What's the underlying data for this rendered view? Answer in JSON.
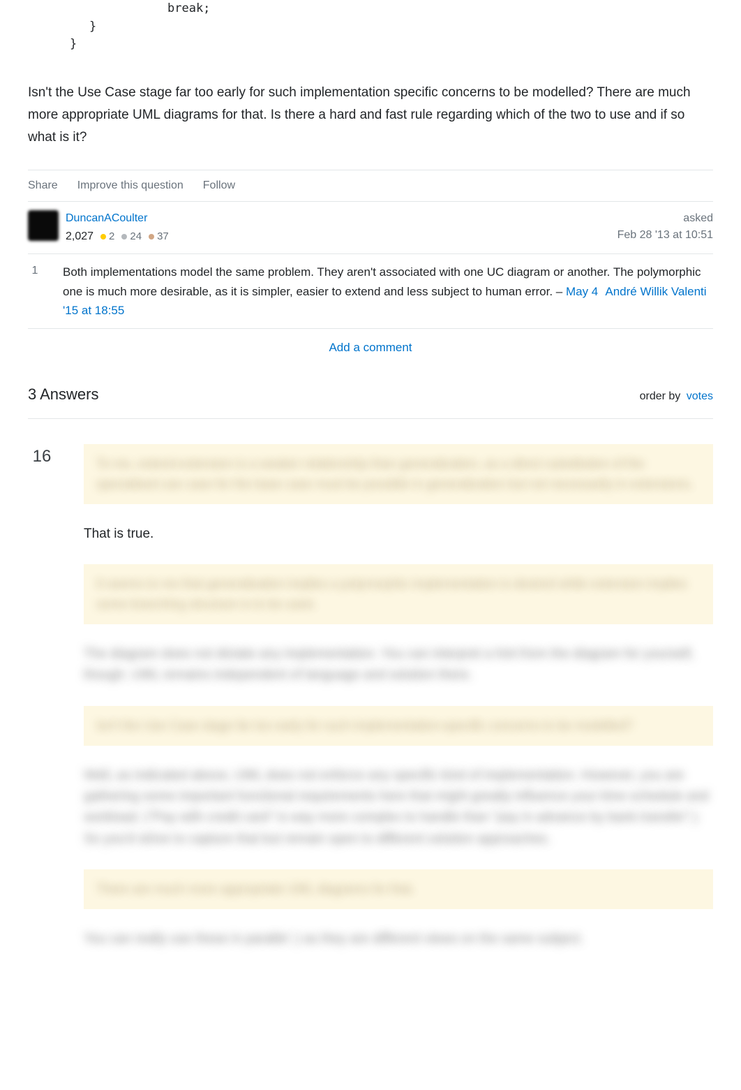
{
  "code": {
    "line1": "break;",
    "line2": "}",
    "line3": "}"
  },
  "question": {
    "body": "Isn't the Use Case stage far too early for such implementation specific concerns to be modelled? There are much more appropriate UML diagrams for that. Is there a hard and fast rule regarding which of the two to use and if so what is it?"
  },
  "post_actions": {
    "share": "Share",
    "improve": "Improve this question",
    "follow": "Follow"
  },
  "author": {
    "name": "DuncanACoulter",
    "reputation": "2,027",
    "gold": "2",
    "silver": "24",
    "bronze": "37"
  },
  "asked": {
    "label": "asked",
    "date": "Feb 28 '13 at 10:51"
  },
  "comment": {
    "votes": "1",
    "text": "Both implementations model the same problem. They aren't associated with one UC diagram or another. The polymorphic one is much more desirable, as it is simpler, easier to extend and less subject to human error. – ",
    "author": "André Willik Valenti",
    "date": "May 4 '15 at 18:55"
  },
  "add_comment": "Add a comment",
  "answers": {
    "count": "3 Answers",
    "order_label": "order by",
    "order_value": "votes"
  },
  "answer": {
    "votes": "16",
    "quote1": "To me, extend-extension is a weaker relationship than generalization, as a direct substitution of the specialised use case for the base case must be possible in generalization but not necessarily in extensions.",
    "p1": "That is true.",
    "quote2": "It seems to me that generalisation implies a polymorphic implementation is desired while extension implies some branching structure is to be used.",
    "p2": "The diagram does not dictate any implementation. You can interpret a hint from the diagram for yourself, though. UML remains independent of language and solution there.",
    "quote3": "Isn't the Use Case stage far too early for such implementation-specific concerns to be modelled?",
    "p3": "Well, as indicated above, UML does not enforce any specific kind of implementation. However, you are gathering some important functional requirements here that might greatly influence your time schedule and workload. (\"Pay with credit card\" is way more complex to handle than \"pay in advance by bank transfer\".) So you'd strive to capture that but remain open to different solution approaches.",
    "quote4": "There are much more appropriate UML diagrams for that.",
    "p4": "You can really use these in parallel :) as they are different views on the same subject."
  }
}
